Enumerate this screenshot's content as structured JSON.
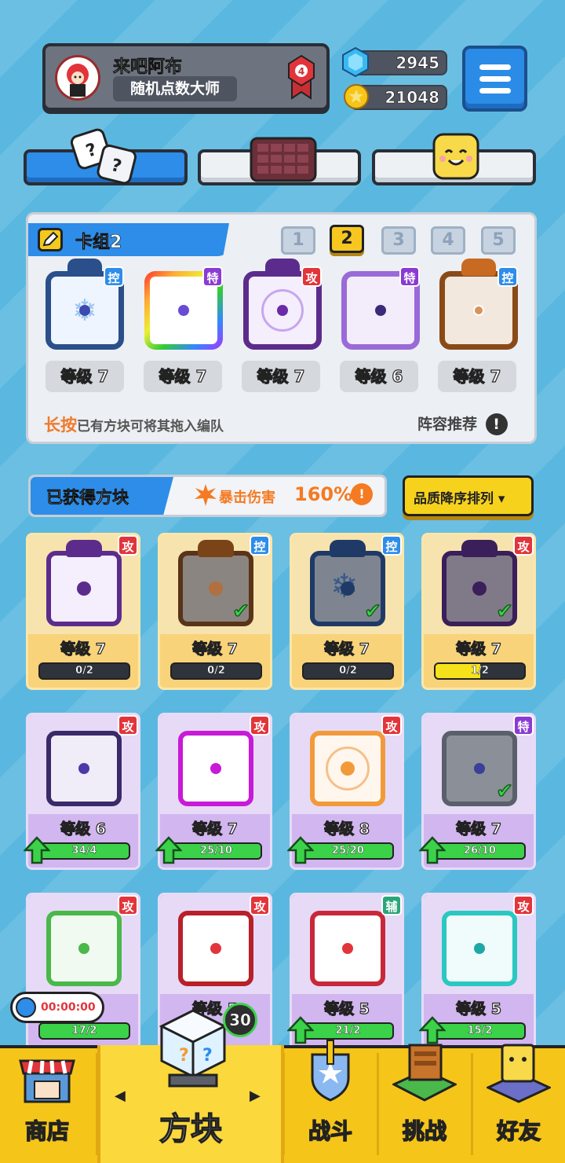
{
  "profile": {
    "name": "来吧阿布",
    "title": "随机点数大师",
    "rank": "4"
  },
  "currency": {
    "gems": "2945",
    "coins": "21048"
  },
  "deck": {
    "name": "卡组2",
    "pages": [
      "1",
      "2",
      "3",
      "4",
      "5"
    ],
    "active_page": "2",
    "slots": [
      {
        "badge": "控",
        "level": "等级 7"
      },
      {
        "badge": "特",
        "level": "等级 7"
      },
      {
        "badge": "攻",
        "level": "等级 7"
      },
      {
        "badge": "特",
        "level": "等级 6"
      },
      {
        "badge": "控",
        "level": "等级 7"
      }
    ],
    "hint_prefix": "长按",
    "hint": "已有方块可将其拖入编队",
    "recommend": "阵容推荐"
  },
  "obtained": {
    "title": "已获得方块",
    "crit_label": "暴击伤害",
    "crit_value": "160%",
    "sort_label": "品质降序排列 ▾"
  },
  "cards": [
    {
      "badge": "攻",
      "level": "等级 7",
      "progress": "0/2",
      "fill": 0
    },
    {
      "badge": "控",
      "level": "等级 7",
      "progress": "0/2",
      "fill": 0
    },
    {
      "badge": "控",
      "level": "等级 7",
      "progress": "0/2",
      "fill": 0
    },
    {
      "badge": "攻",
      "level": "等级 7",
      "progress": "1/2",
      "fill": 0.5
    },
    {
      "badge": "攻",
      "level": "等级 6",
      "progress": "34/4",
      "fill": 1
    },
    {
      "badge": "攻",
      "level": "等级 7",
      "progress": "25/10",
      "fill": 1
    },
    {
      "badge": "攻",
      "level": "等级 8",
      "progress": "25/20",
      "fill": 1
    },
    {
      "badge": "特",
      "level": "等级 7",
      "progress": "26/10",
      "fill": 1
    },
    {
      "badge": "攻",
      "level": "",
      "progress": "17/2",
      "fill": 1
    },
    {
      "badge": "攻",
      "level": "等级 5",
      "progress": "",
      "fill": 1
    },
    {
      "badge": "辅",
      "level": "等级 5",
      "progress": "21/2",
      "fill": 1
    },
    {
      "badge": "攻",
      "level": "等级 5",
      "progress": "15/2",
      "fill": 1
    }
  ],
  "timer": "00:00:00",
  "dice_count": "30",
  "nav": [
    "商店",
    "方块",
    "战斗",
    "挑战",
    "好友"
  ],
  "colors": {
    "blue": "#2d8de8",
    "gold": "#f5c51a",
    "attack": "#e2353b",
    "control": "#2d8de8",
    "special": "#8a3bd4",
    "support": "#2aa67a"
  }
}
